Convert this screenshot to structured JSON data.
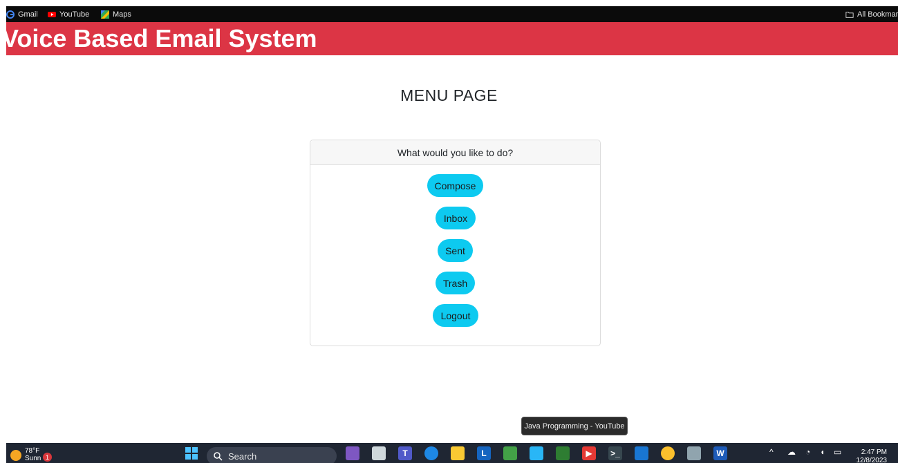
{
  "bookmarks": {
    "items": [
      {
        "label": "Gmail",
        "icon": "google-icon"
      },
      {
        "label": "YouTube",
        "icon": "youtube-icon"
      },
      {
        "label": "Maps",
        "icon": "maps-icon"
      }
    ],
    "all_bookmarks": "All Bookmar"
  },
  "header": {
    "title": "Voice Based Email System"
  },
  "main": {
    "heading": "MENU PAGE",
    "card_header": "What would you like to do?",
    "buttons": {
      "compose": "Compose",
      "inbox": "Inbox",
      "sent": "Sent",
      "trash": "Trash",
      "logout": "Logout"
    }
  },
  "tooltip": "Java Programming - YouTube",
  "taskbar": {
    "weather_temp": "78°F",
    "weather_desc": "Sunn",
    "notification_count": "1",
    "search_placeholder": "Search",
    "time": "2:47 PM",
    "date": "12/8/2023"
  },
  "colors": {
    "header_bg": "#dc3545",
    "button_bg": "#0dcaf0",
    "bookmarks_bg": "#0b0b0b",
    "taskbar_bg": "#1f2633"
  }
}
